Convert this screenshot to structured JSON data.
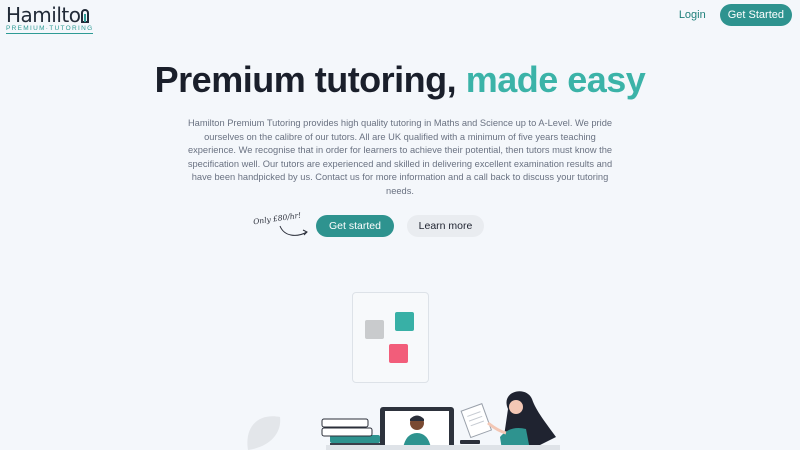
{
  "header": {
    "logo_word": "Hamilto",
    "logo_tagline": "PREMIUM·TUTORING",
    "login_label": "Login",
    "cta_label": "Get Started"
  },
  "hero": {
    "title_main": "Premium tutoring,",
    "title_accent": "made easy",
    "description": "Hamilton Premium Tutoring provides high quality tutoring in Maths and Science up to A-Level. We pride ourselves on the calibre of our tutors. All are UK qualified with a minimum of five years teaching experience. We recognise that in order for learners to achieve their potential, then tutors must know the specification well. Our tutors are experienced and skilled in delivering excellent examination results and have been handpicked by us. Contact us for more information and a call back to discuss your tutoring needs.",
    "price_note": "Only £80/hr!",
    "primary_cta": "Get started",
    "secondary_cta": "Learn more"
  },
  "colors": {
    "brand_teal": "#2e938f",
    "accent_teal": "#3bb3a8",
    "pink": "#f25d7a",
    "background": "#f4f7fb"
  }
}
